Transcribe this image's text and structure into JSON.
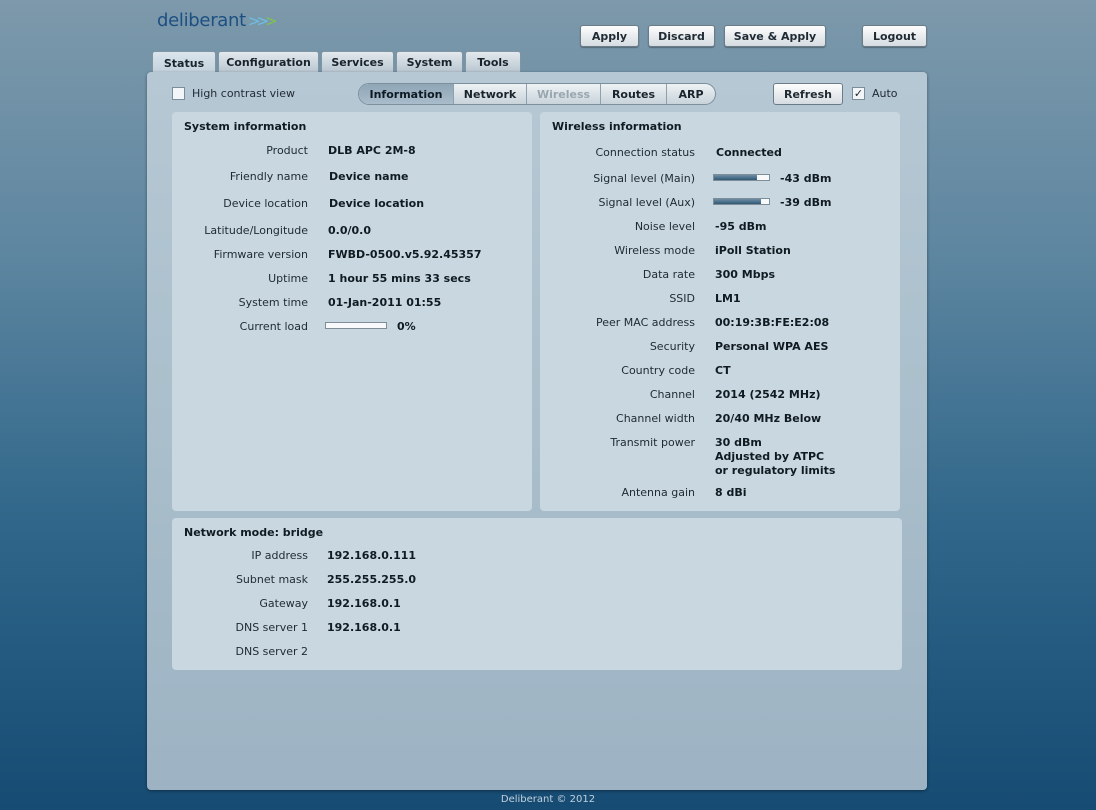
{
  "brand": {
    "name": "deliberant"
  },
  "header": {
    "apply": "Apply",
    "discard": "Discard",
    "save_apply": "Save & Apply",
    "logout": "Logout"
  },
  "main_tabs": [
    "Status",
    "Configuration",
    "Services",
    "System",
    "Tools"
  ],
  "toolbar": {
    "high_contrast": "High contrast view",
    "refresh": "Refresh",
    "auto": "Auto",
    "auto_checked": true,
    "subtabs": [
      "Information",
      "Network",
      "Wireless",
      "Routes",
      "ARP"
    ]
  },
  "system_info": {
    "title": "System information",
    "rows": [
      {
        "label": "Product",
        "value": "DLB APC 2M-8"
      },
      {
        "label": "Friendly name",
        "value": "Device name"
      },
      {
        "label": "Device location",
        "value": "Device location"
      },
      {
        "label": "Latitude/Longitude",
        "value": "0.0/0.0"
      },
      {
        "label": "Firmware version",
        "value": "FWBD-0500.v5.92.45357"
      },
      {
        "label": "Uptime",
        "value": "1 hour 55 mins 33 secs"
      },
      {
        "label": "System time",
        "value": "01-Jan-2011 01:55"
      },
      {
        "label": "Current load",
        "value": "0%"
      }
    ],
    "current_load_fraction": 0.0
  },
  "wireless_info": {
    "title": "Wireless information",
    "rows": [
      {
        "label": "Connection status",
        "value": "Connected"
      },
      {
        "label": "Signal level (Main)",
        "value": "-43 dBm"
      },
      {
        "label": "Signal level (Aux)",
        "value": "-39 dBm"
      },
      {
        "label": "Noise level",
        "value": "-95 dBm"
      },
      {
        "label": "Wireless mode",
        "value": "iPoll Station"
      },
      {
        "label": "Data rate",
        "value": "300 Mbps"
      },
      {
        "label": "SSID",
        "value": "LM1"
      },
      {
        "label": "Peer MAC address",
        "value": "00:19:3B:FE:E2:08"
      },
      {
        "label": "Security",
        "value": "Personal WPA AES"
      },
      {
        "label": "Country code",
        "value": "CT"
      },
      {
        "label": "Channel",
        "value": "2014 (2542 MHz)"
      },
      {
        "label": "Channel width",
        "value": "20/40 MHz Below"
      },
      {
        "label": "Transmit power",
        "value": "30 dBm"
      },
      {
        "label": "Antenna gain",
        "value": "8 dBi"
      }
    ],
    "transmit_note_1": "Adjusted by ATPC",
    "transmit_note_2": "or regulatory limits",
    "signal_main_fraction": 0.78,
    "signal_aux_fraction": 0.85
  },
  "network_info": {
    "title": "Network mode: bridge",
    "rows": [
      {
        "label": "IP address",
        "value": "192.168.0.111"
      },
      {
        "label": "Subnet mask",
        "value": "255.255.255.0"
      },
      {
        "label": "Gateway",
        "value": "192.168.0.1"
      },
      {
        "label": "DNS server 1",
        "value": "192.168.0.1"
      },
      {
        "label": "DNS server 2",
        "value": ""
      }
    ]
  },
  "footer": "Deliberant © 2012"
}
